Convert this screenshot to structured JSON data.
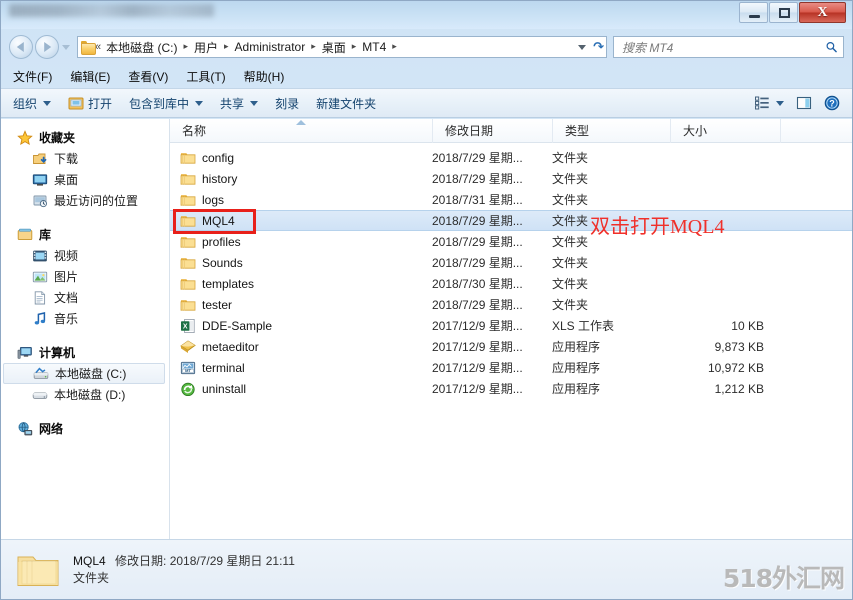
{
  "window": {
    "title": "",
    "controls": {
      "minimize": "–",
      "maximize": "□",
      "close": "X"
    }
  },
  "address": {
    "chevrons": "«",
    "crumbs": [
      "本地磁盘 (C:)",
      "用户",
      "Administrator",
      "桌面",
      "MT4"
    ],
    "separator": "▸",
    "refresh_icon": "refresh-icon"
  },
  "search": {
    "placeholder": "搜索 MT4",
    "value": ""
  },
  "menubar": {
    "items": [
      "文件(F)",
      "编辑(E)",
      "查看(V)",
      "工具(T)",
      "帮助(H)"
    ]
  },
  "toolbar": {
    "organize": "组织",
    "open": "打开",
    "include_in_library": "包含到库中",
    "share": "共享",
    "burn": "刻录",
    "new_folder": "新建文件夹",
    "view_icon": "view-list-icon",
    "preview_icon": "preview-pane-icon",
    "help_icon": "help-icon"
  },
  "navpane": {
    "groups": [
      {
        "label": "收藏夹",
        "icon": "star-icon",
        "items": [
          {
            "label": "下载",
            "icon": "downloads-icon"
          },
          {
            "label": "桌面",
            "icon": "desktop-icon"
          },
          {
            "label": "最近访问的位置",
            "icon": "recent-places-icon"
          }
        ]
      },
      {
        "label": "库",
        "icon": "library-icon",
        "items": [
          {
            "label": "视频",
            "icon": "videos-icon"
          },
          {
            "label": "图片",
            "icon": "pictures-icon"
          },
          {
            "label": "文档",
            "icon": "documents-icon"
          },
          {
            "label": "音乐",
            "icon": "music-icon"
          }
        ]
      },
      {
        "label": "计算机",
        "icon": "computer-icon",
        "items": [
          {
            "label": "本地磁盘 (C:)",
            "icon": "system-drive-icon",
            "selected": true
          },
          {
            "label": "本地磁盘 (D:)",
            "icon": "drive-icon",
            "selected": false
          }
        ]
      },
      {
        "label": "网络",
        "icon": "network-icon",
        "items": []
      }
    ]
  },
  "filelist": {
    "columns": {
      "name": "名称",
      "date": "修改日期",
      "type": "类型",
      "size": "大小"
    },
    "sort_column": "name",
    "sort_direction": "ascending",
    "rows": [
      {
        "name": "config",
        "date": "2018/7/29 星期...",
        "type": "文件夹",
        "size": "",
        "icon": "folder-icon",
        "selected": false
      },
      {
        "name": "history",
        "date": "2018/7/29 星期...",
        "type": "文件夹",
        "size": "",
        "icon": "folder-icon",
        "selected": false
      },
      {
        "name": "logs",
        "date": "2018/7/31 星期...",
        "type": "文件夹",
        "size": "",
        "icon": "folder-icon",
        "selected": false
      },
      {
        "name": "MQL4",
        "date": "2018/7/29 星期...",
        "type": "文件夹",
        "size": "",
        "icon": "folder-icon",
        "selected": true
      },
      {
        "name": "profiles",
        "date": "2018/7/29 星期...",
        "type": "文件夹",
        "size": "",
        "icon": "folder-icon",
        "selected": false
      },
      {
        "name": "Sounds",
        "date": "2018/7/29 星期...",
        "type": "文件夹",
        "size": "",
        "icon": "folder-icon",
        "selected": false
      },
      {
        "name": "templates",
        "date": "2018/7/30 星期...",
        "type": "文件夹",
        "size": "",
        "icon": "folder-icon",
        "selected": false
      },
      {
        "name": "tester",
        "date": "2018/7/29 星期...",
        "type": "文件夹",
        "size": "",
        "icon": "folder-icon",
        "selected": false
      },
      {
        "name": "DDE-Sample",
        "date": "2017/12/9 星期...",
        "type": "XLS 工作表",
        "size": "10 KB",
        "icon": "excel-file-icon",
        "selected": false
      },
      {
        "name": "metaeditor",
        "date": "2017/12/9 星期...",
        "type": "应用程序",
        "size": "9,873 KB",
        "icon": "metaeditor-app-icon",
        "selected": false
      },
      {
        "name": "terminal",
        "date": "2017/12/9 星期...",
        "type": "应用程序",
        "size": "10,972 KB",
        "icon": "terminal-app-icon",
        "selected": false
      },
      {
        "name": "uninstall",
        "date": "2017/12/9 星期...",
        "type": "应用程序",
        "size": "1,212 KB",
        "icon": "uninstall-app-icon",
        "selected": false
      }
    ]
  },
  "annotation": {
    "text": "双击打开MQL4",
    "color": "#f0302a",
    "highlight_color": "#e8201a",
    "target_row": "MQL4"
  },
  "statusbar": {
    "name": "MQL4",
    "detail": "修改日期: 2018/7/29 星期日 21:11",
    "type": "文件夹",
    "icon": "folder-large-icon"
  },
  "watermark": {
    "text": "518外汇网"
  }
}
